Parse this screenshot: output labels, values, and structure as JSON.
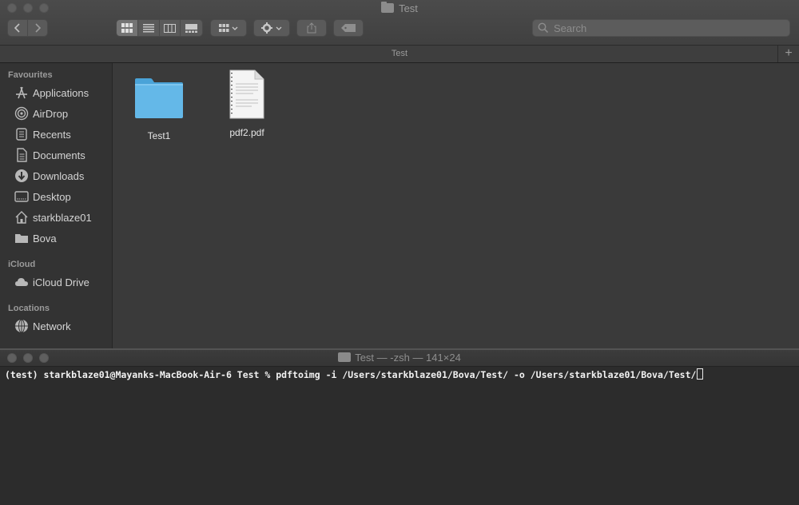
{
  "finder": {
    "window_title": "Test",
    "path_bar": "Test",
    "search_placeholder": "Search",
    "plus": "+",
    "sidebar": {
      "favourites_header": "Favourites",
      "favourites": [
        {
          "label": "Applications",
          "icon": "applications-icon"
        },
        {
          "label": "AirDrop",
          "icon": "airdrop-icon"
        },
        {
          "label": "Recents",
          "icon": "recents-icon"
        },
        {
          "label": "Documents",
          "icon": "documents-icon"
        },
        {
          "label": "Downloads",
          "icon": "downloads-icon"
        },
        {
          "label": "Desktop",
          "icon": "desktop-icon"
        },
        {
          "label": "starkblaze01",
          "icon": "home-icon"
        },
        {
          "label": "Bova",
          "icon": "folder-icon"
        }
      ],
      "icloud_header": "iCloud",
      "icloud": [
        {
          "label": "iCloud Drive",
          "icon": "cloud-icon"
        }
      ],
      "locations_header": "Locations",
      "locations": [
        {
          "label": "Network",
          "icon": "network-icon"
        }
      ]
    },
    "files": [
      {
        "name": "Test1",
        "type": "folder"
      },
      {
        "name": "pdf2.pdf",
        "type": "pdf"
      }
    ],
    "colors": {
      "folder": "#5fb3e3",
      "background": "#3a3a3a"
    }
  },
  "terminal": {
    "title": "Test — -zsh — 141×24",
    "command_line": "(test) starkblaze01@Mayanks-MacBook-Air-6 Test % pdftoimg -i /Users/starkblaze01/Bova/Test/ -o /Users/starkblaze01/Bova/Test/"
  }
}
